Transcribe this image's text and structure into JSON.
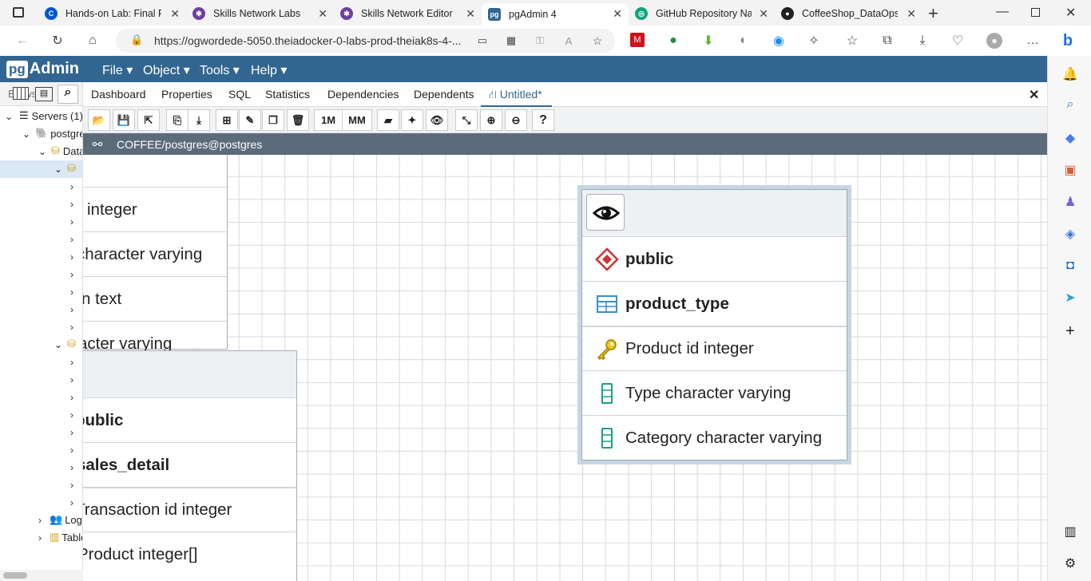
{
  "browser_tabs": [
    {
      "label": "Hands-on Lab: Final Pr",
      "icon": "coursera-icon",
      "color": "#0056d2"
    },
    {
      "label": "Skills Network Labs",
      "icon": "skills-network-icon",
      "color": "#6d3fa0"
    },
    {
      "label": "Skills Network Editor",
      "icon": "skills-network-icon",
      "color": "#6d3fa0"
    },
    {
      "label": "pgAdmin 4",
      "icon": "pgadmin-icon",
      "color": "#326690"
    },
    {
      "label": "GitHub Repository Nar",
      "icon": "chatgpt-icon",
      "color": "#10a37f"
    },
    {
      "label": "CoffeeShop_DataOps/",
      "icon": "github-icon",
      "color": "#222222"
    }
  ],
  "address": {
    "url": "https://ogwordede-5050.theiadocker-0-labs-prod-theiak8s-4-..."
  },
  "pgadmin": {
    "logo_pg": "pg",
    "logo_admin": "Admin",
    "menus": [
      "File",
      "Object",
      "Tools",
      "Help"
    ]
  },
  "tree": {
    "browser_label": "Browser",
    "servers": "Servers (1)",
    "postgres": "postgres",
    "databases": "Databases",
    "login": "Login/Group Roles",
    "tablespaces": "Tablespaces"
  },
  "main_tabs": [
    "Dashboard",
    "Properties",
    "SQL",
    "Statistics",
    "Dependencies",
    "Dependents",
    "Untitled*"
  ],
  "toolbar": {
    "one_to_many": "1M",
    "many_to_many": "MM",
    "help": "?"
  },
  "connection": "COFFEE/postgres@postgres",
  "entities": {
    "product_type": {
      "schema": "public",
      "name": "product_type",
      "columns": [
        {
          "label": "Product id integer",
          "kind": "primary-key"
        },
        {
          "label": "Type character varying",
          "kind": "column"
        },
        {
          "label": "Category character varying",
          "kind": "column"
        }
      ]
    },
    "sales_detail": {
      "schema": "public",
      "name": "sales_detail",
      "columns": [
        "Transaction id integer",
        "Product  integer[]"
      ]
    },
    "hidden_table": {
      "columns": [
        "integer",
        "character varying",
        "n text",
        "acter varying"
      ]
    }
  },
  "colors": {
    "nav": "#326690",
    "conn_bar": "#5b6b7a",
    "accent": "#326690"
  }
}
